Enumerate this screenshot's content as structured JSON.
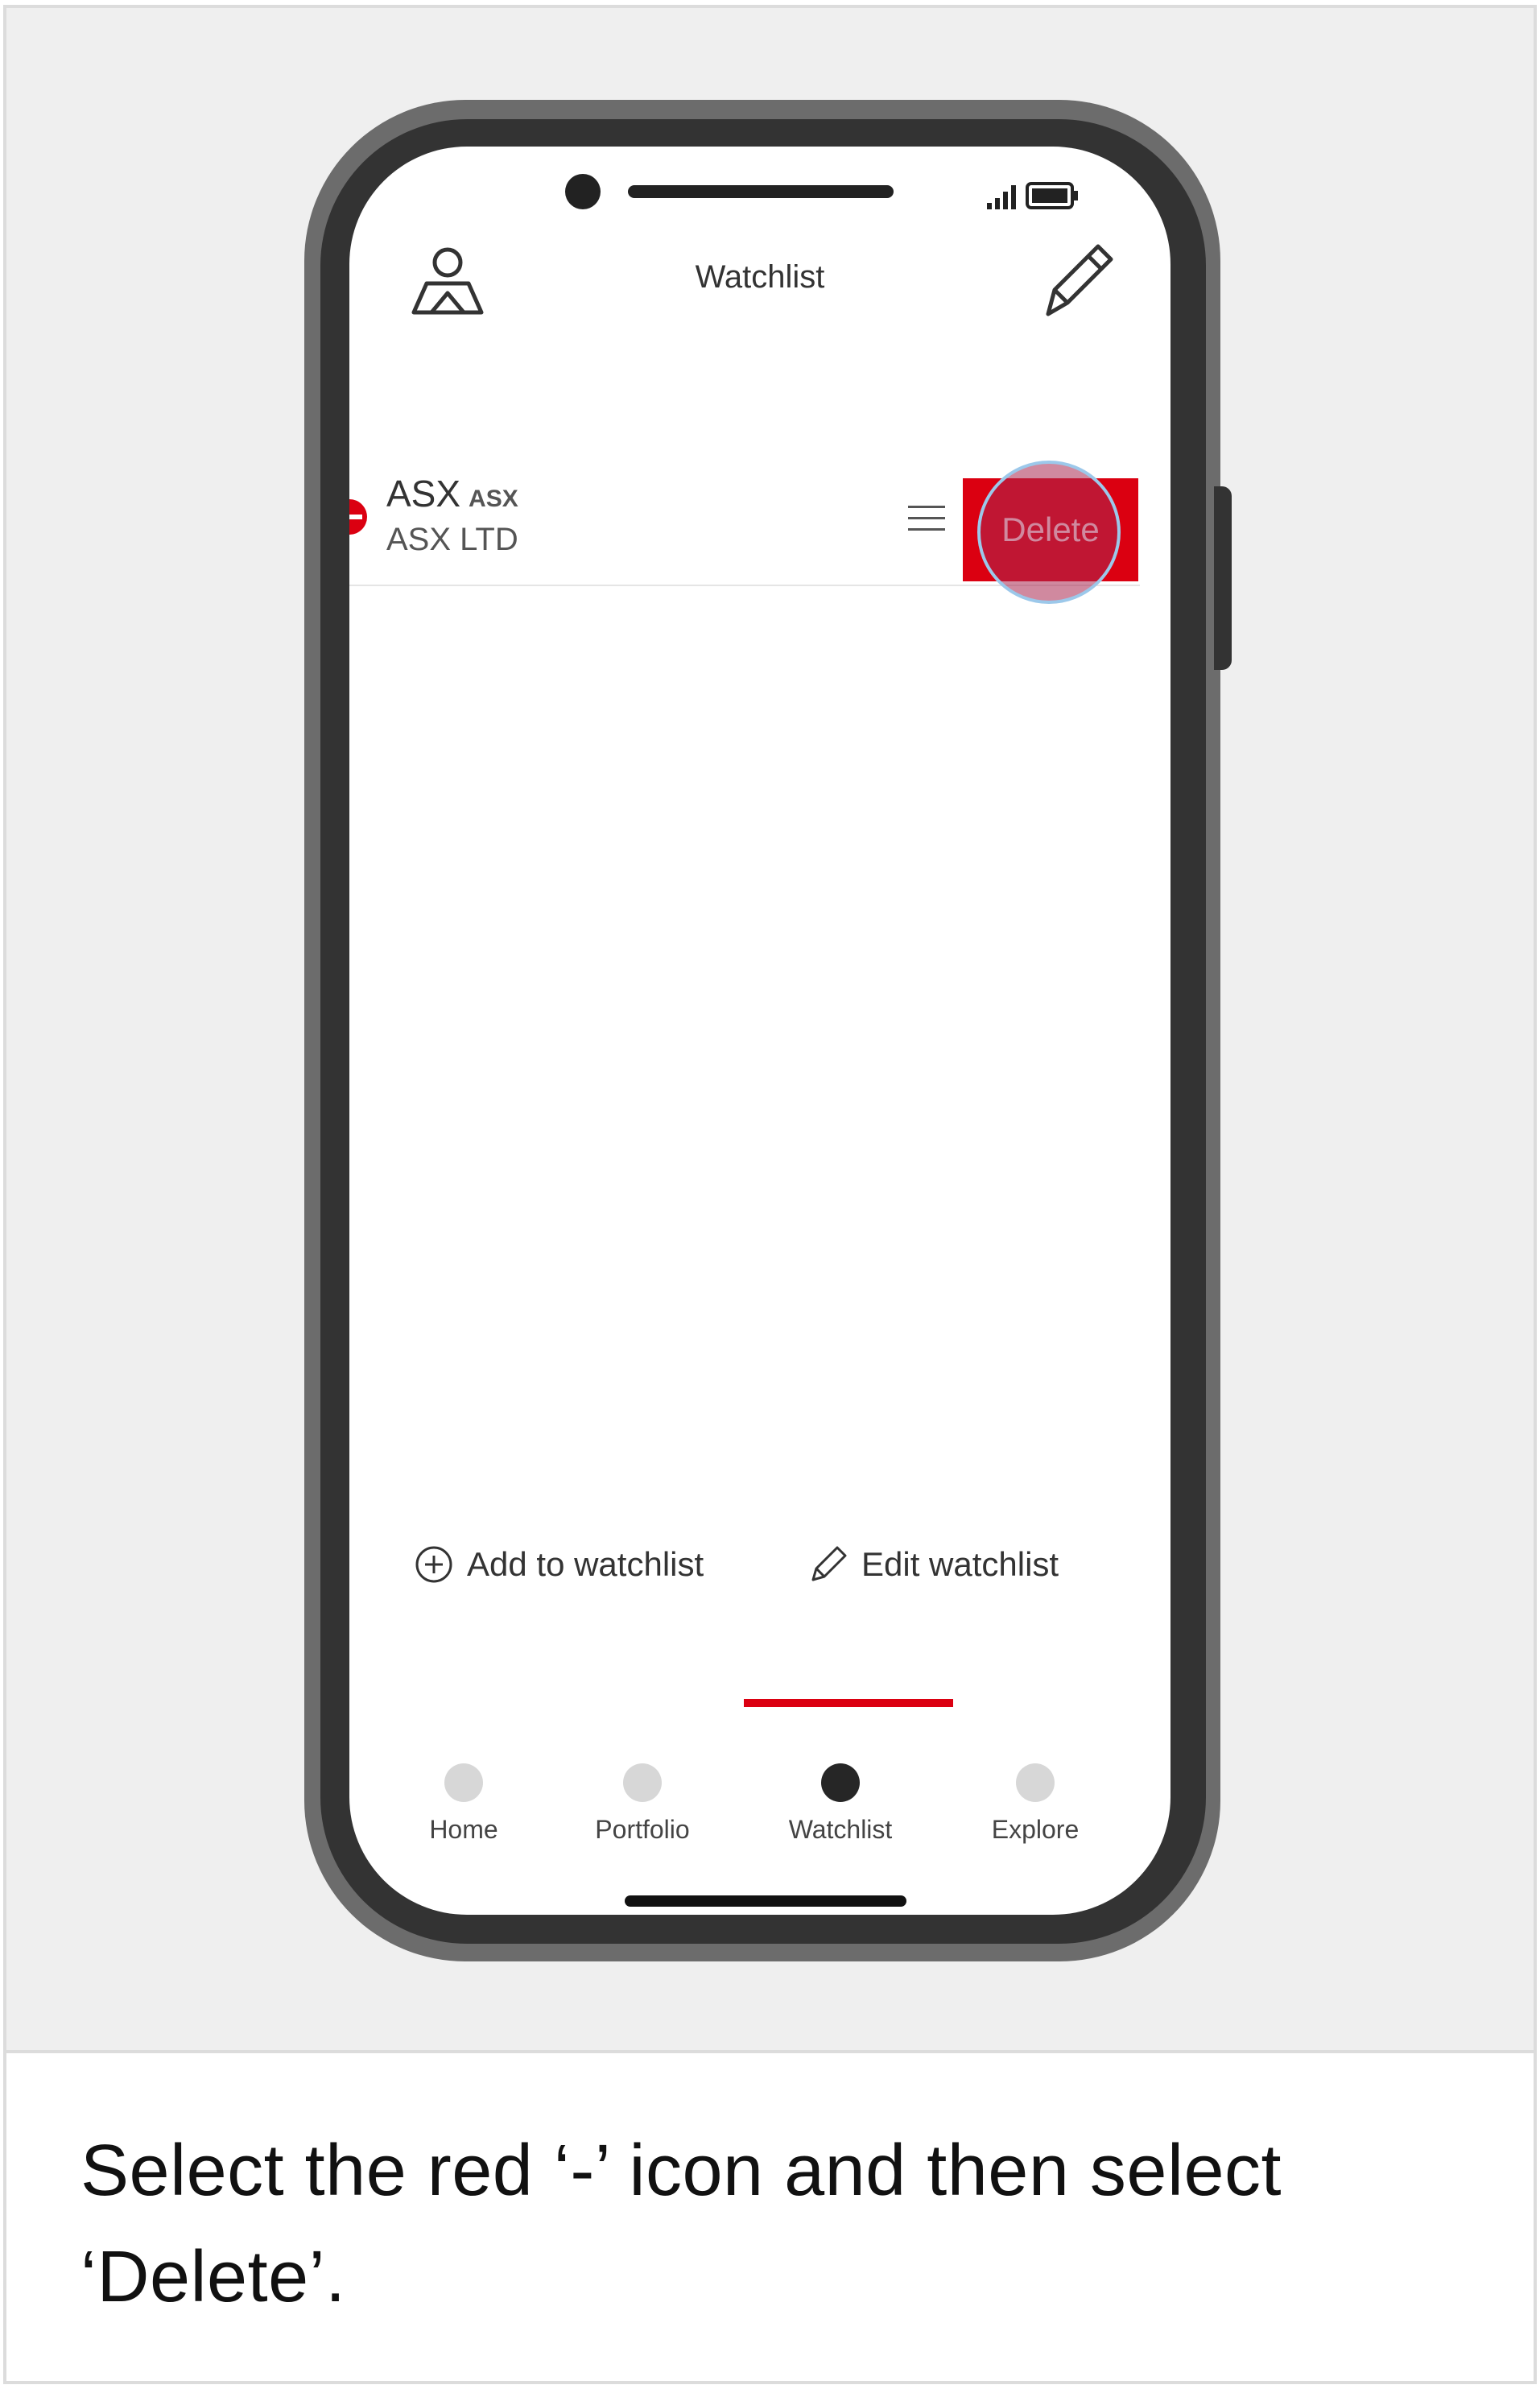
{
  "header": {
    "title": "Watchlist"
  },
  "watchlist": {
    "items": [
      {
        "symbol": "ASX",
        "exchange": "ASX",
        "name": "ASX LTD",
        "delete_label": "Delete"
      }
    ]
  },
  "actions": {
    "add_label": "Add to watchlist",
    "edit_label": "Edit watchlist"
  },
  "tabs": [
    {
      "label": "Home",
      "active": false
    },
    {
      "label": "Portfolio",
      "active": false
    },
    {
      "label": "Watchlist",
      "active": true
    },
    {
      "label": "Explore",
      "active": false
    }
  ],
  "caption": "Select the red ‘-’ icon and then select ‘Delete’.",
  "colors": {
    "accent": "#db0011",
    "bezel": "#333333",
    "frame": "#6c6c6c",
    "background": "#efefef"
  },
  "icons": {
    "profile": "profile-icon",
    "edit": "pencil-icon",
    "remove": "minus-circle-icon",
    "drag": "drag-handle-icon",
    "add": "plus-circle-icon"
  }
}
